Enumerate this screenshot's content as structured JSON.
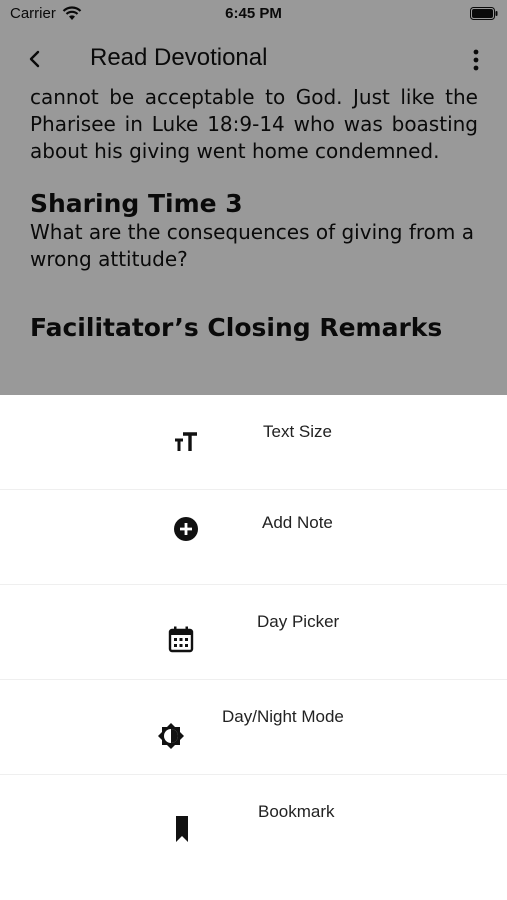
{
  "status_bar": {
    "carrier": "Carrier",
    "time": "6:45 PM"
  },
  "navbar": {
    "title": "Read Devotional"
  },
  "content": {
    "paragraph_partial": "through the ... cannot be acceptable",
    "paragraph": "cannot be acceptable to God. Just like the Pharisee in Luke 18:9-14 who was boasting about his giving went home condemned.",
    "sharing_title": "Sharing Time 3",
    "sharing_body": "What are the consequences of giving from a wrong attitude?",
    "closing_title": "Facilitator’s Closing Remarks"
  },
  "menu": {
    "text_size": "Text Size",
    "add_note": "Add Note",
    "day_picker": "Day Picker",
    "day_night_mode": "Day/Night Mode",
    "bookmark": "Bookmark"
  },
  "colors": {
    "overlay": "#000000",
    "icon": "#111111",
    "divider": "#efefef"
  }
}
